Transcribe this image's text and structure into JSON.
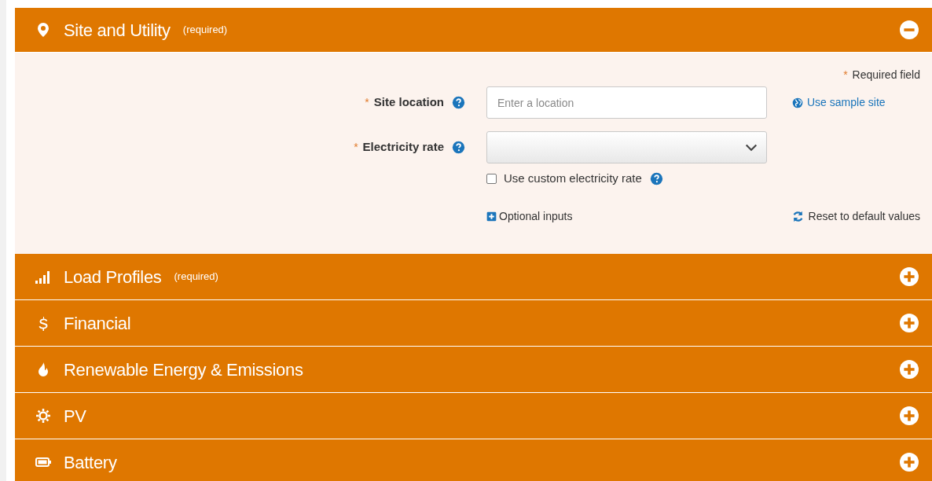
{
  "sections": [
    {
      "title": "Site and Utility",
      "note": "(required)",
      "expanded": true,
      "form": {
        "required_mark": "*",
        "required_note": "Required field",
        "fields": [
          {
            "kind": "text",
            "label": "Site location",
            "required": true,
            "placeholder": "Enter a location",
            "link": "Use sample site"
          },
          {
            "kind": "select",
            "label": "Electricity rate",
            "required": true
          }
        ],
        "checkbox": {
          "label": "Use custom electricity rate",
          "checked": false
        },
        "optional_link": "Optional inputs",
        "reset_link": "Reset to default values"
      }
    },
    {
      "title": "Load Profiles",
      "note": "(required)",
      "expanded": false
    },
    {
      "title": "Financial",
      "expanded": false
    },
    {
      "title": "Renewable Energy & Emissions",
      "expanded": false
    },
    {
      "title": "PV",
      "expanded": false
    },
    {
      "title": "Battery",
      "expanded": false
    }
  ]
}
